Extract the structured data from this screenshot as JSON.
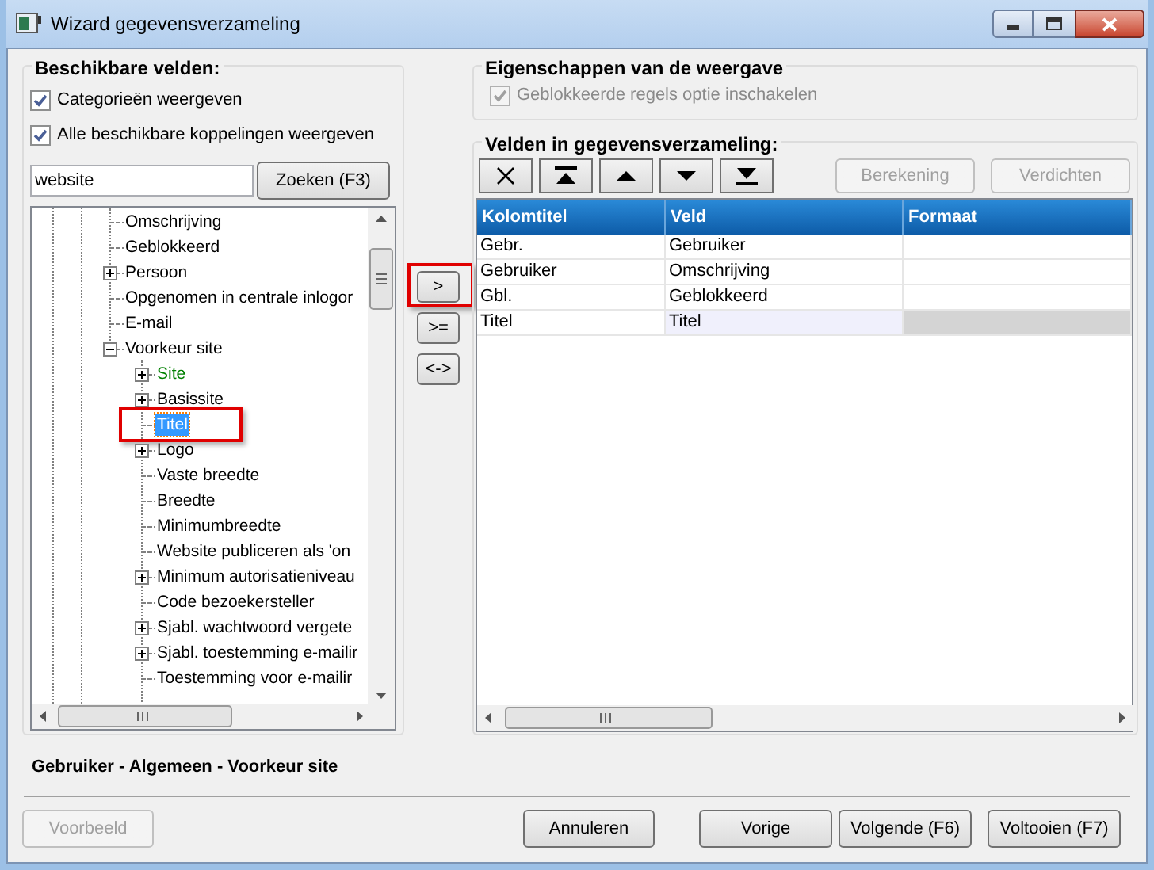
{
  "window": {
    "title": "Wizard gegevensverzameling"
  },
  "available_fields": {
    "title": "Beschikbare velden:",
    "options": [
      {
        "label": "Categorieën weergeven",
        "checked": true
      },
      {
        "label": "Alle beschikbare koppelingen weergeven",
        "checked": true
      }
    ],
    "search": {
      "value": "website",
      "button": "Zoeken (F3)"
    },
    "tree": [
      {
        "label": "Omschrijving",
        "kind": "leaf",
        "selected": false,
        "color": "#000000",
        "callout": false
      },
      {
        "label": "Geblokkeerd",
        "kind": "leaf",
        "selected": false,
        "color": "#000000",
        "callout": false
      },
      {
        "label": "Persoon",
        "kind": "collapsed",
        "selected": false,
        "color": "#000000",
        "callout": false
      },
      {
        "label": "Opgenomen in centrale inlogor",
        "kind": "leaf",
        "selected": false,
        "color": "#000000",
        "callout": false
      },
      {
        "label": "E-mail",
        "kind": "leaf",
        "selected": false,
        "color": "#000000",
        "callout": false
      },
      {
        "label": "Voorkeur site",
        "kind": "expanded",
        "selected": false,
        "color": "#000000",
        "callout": false,
        "children": [
          {
            "label": "Site",
            "kind": "collapsed",
            "selected": false,
            "color": "#008000",
            "callout": false
          },
          {
            "label": "Basissite",
            "kind": "collapsed",
            "selected": false,
            "color": "#000000",
            "callout": false
          },
          {
            "label": "Titel",
            "kind": "leaf",
            "selected": true,
            "callout": true
          },
          {
            "label": "Logo",
            "kind": "collapsed",
            "selected": false,
            "color": "#000000",
            "callout": false
          },
          {
            "label": "Vaste breedte",
            "kind": "leaf",
            "selected": false,
            "color": "#000000",
            "callout": false
          },
          {
            "label": "Breedte",
            "kind": "leaf",
            "selected": false,
            "color": "#000000",
            "callout": false
          },
          {
            "label": "Minimumbreedte",
            "kind": "leaf",
            "selected": false,
            "color": "#000000",
            "callout": false
          },
          {
            "label": "Website publiceren als 'on",
            "kind": "leaf",
            "selected": false,
            "color": "#000000",
            "callout": false
          },
          {
            "label": "Minimum autorisatieniveau",
            "kind": "collapsed",
            "selected": false,
            "color": "#000000",
            "callout": false
          },
          {
            "label": "Code bezoekersteller",
            "kind": "leaf",
            "selected": false,
            "color": "#000000",
            "callout": false
          },
          {
            "label": "Sjabl. wachtwoord vergete",
            "kind": "collapsed",
            "selected": false,
            "color": "#000000",
            "callout": false
          },
          {
            "label": "Sjabl. toestemming e-mailir",
            "kind": "collapsed",
            "selected": false,
            "color": "#000000",
            "callout": false
          },
          {
            "label": "Toestemming voor e-mailir",
            "kind": "leaf",
            "selected": false,
            "color": "#000000",
            "callout": false
          }
        ]
      }
    ]
  },
  "transfer_buttons": [
    {
      "label": ">",
      "callout": true
    },
    {
      "label": ">=",
      "callout": false
    },
    {
      "label": "<->",
      "callout": false
    }
  ],
  "display_properties": {
    "title": "Eigenschappen van de weergave",
    "option": {
      "label": "Geblokkeerde regels optie inschakelen",
      "checked": true,
      "disabled": true
    }
  },
  "dataset_fields": {
    "title": "Velden in gegevensverzameling:",
    "toolbar": [
      {
        "kind": "delete"
      },
      {
        "kind": "top"
      },
      {
        "kind": "up"
      },
      {
        "kind": "down"
      },
      {
        "kind": "bottom"
      }
    ],
    "actions": [
      {
        "label": "Berekening",
        "disabled": true
      },
      {
        "label": "Verdichten",
        "disabled": true
      }
    ],
    "table": {
      "columns": [
        "Kolomtitel",
        "Veld",
        "Formaat"
      ],
      "rows": [
        {
          "cells": [
            "Gebr.",
            "Gebruiker",
            ""
          ],
          "selected": false
        },
        {
          "cells": [
            "Gebruiker",
            "Omschrijving",
            ""
          ],
          "selected": false
        },
        {
          "cells": [
            "Gbl.",
            "Geblokkeerd",
            ""
          ],
          "selected": false
        },
        {
          "cells": [
            "Titel",
            "Titel",
            ""
          ],
          "selected": true
        }
      ]
    }
  },
  "status_bar": "Gebruiker - Algemeen - Voorkeur site",
  "buttons": [
    {
      "label": "Voorbeeld",
      "disabled": true
    },
    {
      "label": "Annuleren",
      "disabled": false
    },
    {
      "label": "Vorige",
      "disabled": false
    },
    {
      "label": "Volgende (F6)",
      "disabled": false
    },
    {
      "label": "Voltooien (F7)",
      "disabled": false
    }
  ]
}
